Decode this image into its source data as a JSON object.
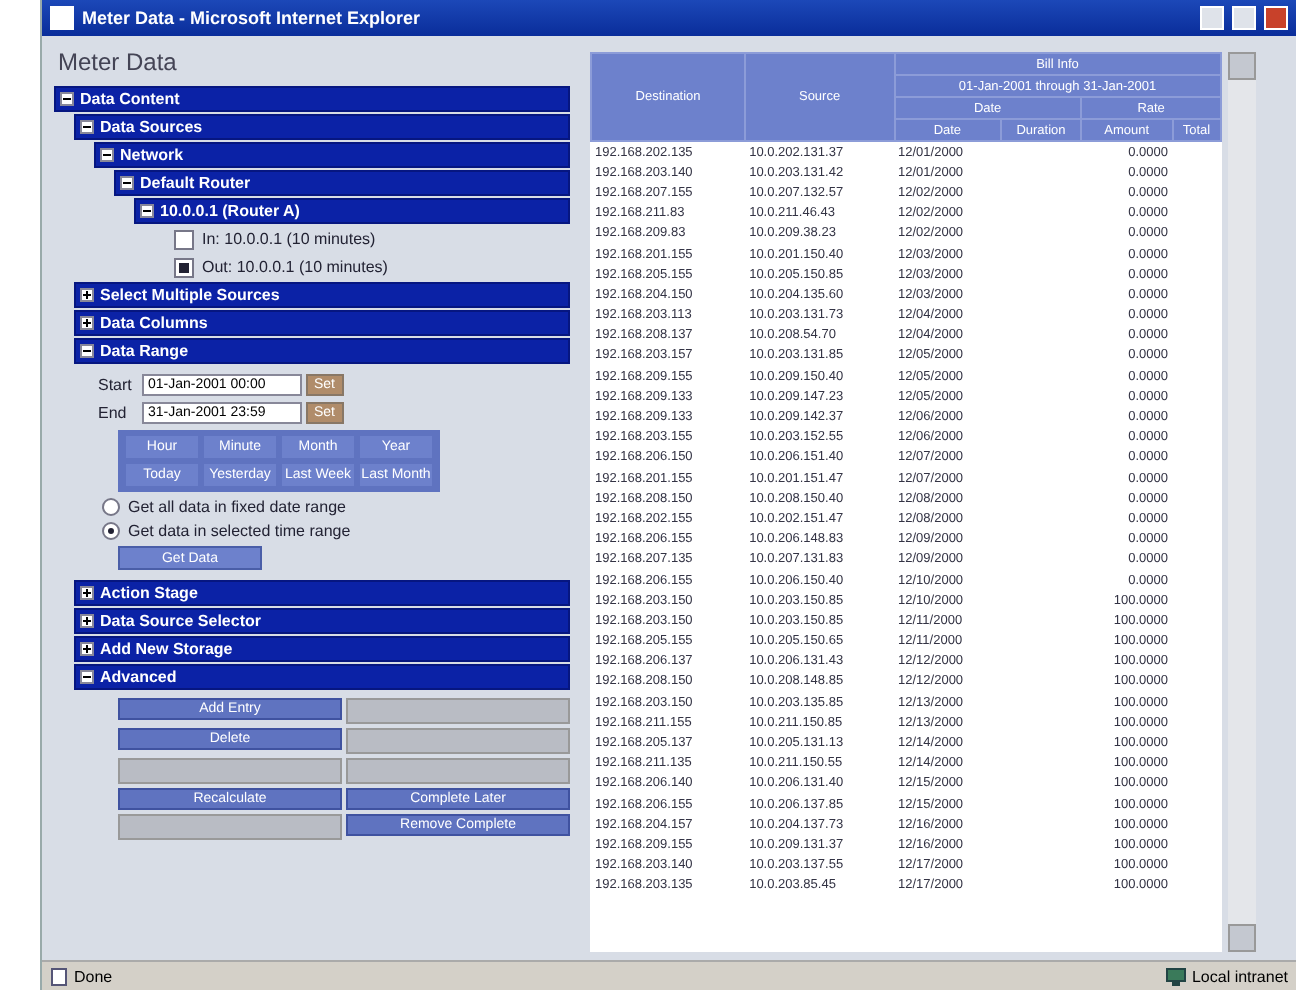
{
  "window": {
    "title": "Meter Data - Microsoft Internet Explorer"
  },
  "page_title": "Meter Data",
  "tree": [
    {
      "label": "Data Content",
      "expanded": true,
      "children": [
        {
          "label": "Data Sources",
          "expanded": true,
          "children": [
            {
              "label": "Network",
              "expanded": true,
              "children": [
                {
                  "label": "Default Router",
                  "expanded": true,
                  "children": [
                    {
                      "label": "10.0.0.1 (Router A)",
                      "expanded": true,
                      "leaves": [
                        {
                          "label": "In: 10.0.0.1 (10 minutes)",
                          "checked": false
                        },
                        {
                          "label": "Out: 10.0.0.1 (10 minutes)",
                          "checked": true
                        }
                      ]
                    }
                  ]
                }
              ]
            }
          ]
        },
        {
          "label": "Select Multiple Sources",
          "expanded": false
        },
        {
          "label": "Data Columns",
          "expanded": false
        },
        {
          "label": "Data Range",
          "expanded": true,
          "form": {
            "start_label": "Start",
            "start_value": "01-Jan-2001 00:00",
            "end_label": "End",
            "end_value": "31-Jan-2001 23:59",
            "start_set": "Set",
            "end_set": "Set",
            "presets": [
              "Hour",
              "Minute",
              "Month",
              "Year",
              "Today",
              "Yesterday",
              "Last Week",
              "Last Month"
            ],
            "options": [
              {
                "label": "Get all data in fixed date range",
                "selected": false
              },
              {
                "label": "Get data in selected time range",
                "selected": true
              }
            ],
            "submit": "Get Data"
          }
        },
        {
          "label": "Action Stage",
          "expanded": false
        },
        {
          "label": "Data Source Selector",
          "expanded": false
        },
        {
          "label": "Add New Storage",
          "expanded": false
        },
        {
          "label": "Advanced",
          "expanded": true,
          "buttons": [
            [
              {
                "kind": "button",
                "label": "Add Entry"
              },
              {
                "kind": "blank"
              }
            ],
            [
              {
                "kind": "button",
                "label": "Delete"
              },
              {
                "kind": "blank"
              }
            ],
            [
              {
                "kind": "blank"
              },
              {
                "kind": "blank"
              }
            ],
            [
              {
                "kind": "button",
                "label": "Recalculate"
              },
              {
                "kind": "button",
                "label": "Complete Later"
              }
            ],
            [
              {
                "kind": "blank"
              },
              {
                "kind": "button",
                "label": "Remove Complete"
              }
            ]
          ]
        }
      ]
    }
  ],
  "table": {
    "columns": [
      "Destination",
      "Source"
    ],
    "group": {
      "title": "Bill Info",
      "subtitle": "01-Jan-2001 through 31-Jan-2001",
      "bands": [
        "Date",
        "Rate"
      ],
      "columns": [
        "Date",
        "Duration",
        "Amount",
        "Total"
      ]
    },
    "rows": [
      [
        "192.168.202.135",
        "10.0.202.131.37",
        "12/01/2000",
        "0.0000"
      ],
      [
        "192.168.203.140",
        "10.0.203.131.42",
        "12/01/2000",
        "0.0000"
      ],
      [
        "192.168.207.155",
        "10.0.207.132.57",
        "12/02/2000",
        "0.0000"
      ],
      [
        "192.168.211.83",
        "10.0.211.46.43",
        "12/02/2000",
        "0.0000"
      ],
      [
        "192.168.209.83",
        "10.0.209.38.23",
        "12/02/2000",
        "0.0000"
      ],
      [
        "192.168.201.155",
        "10.0.201.150.40",
        "12/03/2000",
        "0.0000"
      ],
      [
        "192.168.205.155",
        "10.0.205.150.85",
        "12/03/2000",
        "0.0000"
      ],
      [
        "192.168.204.150",
        "10.0.204.135.60",
        "12/03/2000",
        "0.0000"
      ],
      [
        "192.168.203.113",
        "10.0.203.131.73",
        "12/04/2000",
        "0.0000"
      ],
      [
        "192.168.208.137",
        "10.0.208.54.70",
        "12/04/2000",
        "0.0000"
      ],
      [
        "192.168.203.157",
        "10.0.203.131.85",
        "12/05/2000",
        "0.0000"
      ],
      [
        "192.168.209.155",
        "10.0.209.150.40",
        "12/05/2000",
        "0.0000"
      ],
      [
        "192.168.209.133",
        "10.0.209.147.23",
        "12/05/2000",
        "0.0000"
      ],
      [
        "192.168.209.133",
        "10.0.209.142.37",
        "12/06/2000",
        "0.0000"
      ],
      [
        "192.168.203.155",
        "10.0.203.152.55",
        "12/06/2000",
        "0.0000"
      ],
      [
        "192.168.206.150",
        "10.0.206.151.40",
        "12/07/2000",
        "0.0000"
      ],
      [
        "192.168.201.155",
        "10.0.201.151.47",
        "12/07/2000",
        "0.0000"
      ],
      [
        "192.168.208.150",
        "10.0.208.150.40",
        "12/08/2000",
        "0.0000"
      ],
      [
        "192.168.202.155",
        "10.0.202.151.47",
        "12/08/2000",
        "0.0000"
      ],
      [
        "192.168.206.155",
        "10.0.206.148.83",
        "12/09/2000",
        "0.0000"
      ],
      [
        "192.168.207.135",
        "10.0.207.131.83",
        "12/09/2000",
        "0.0000"
      ],
      [
        "192.168.206.155",
        "10.0.206.150.40",
        "12/10/2000",
        "0.0000"
      ],
      [
        "192.168.203.150",
        "10.0.203.150.85",
        "12/10/2000",
        "100.0000"
      ],
      [
        "192.168.203.150",
        "10.0.203.150.85",
        "12/11/2000",
        "100.0000"
      ],
      [
        "192.168.205.155",
        "10.0.205.150.65",
        "12/11/2000",
        "100.0000"
      ],
      [
        "192.168.206.137",
        "10.0.206.131.43",
        "12/12/2000",
        "100.0000"
      ],
      [
        "192.168.208.150",
        "10.0.208.148.85",
        "12/12/2000",
        "100.0000"
      ],
      [
        "192.168.203.150",
        "10.0.203.135.85",
        "12/13/2000",
        "100.0000"
      ],
      [
        "192.168.211.155",
        "10.0.211.150.85",
        "12/13/2000",
        "100.0000"
      ],
      [
        "192.168.205.137",
        "10.0.205.131.13",
        "12/14/2000",
        "100.0000"
      ],
      [
        "192.168.211.135",
        "10.0.211.150.55",
        "12/14/2000",
        "100.0000"
      ],
      [
        "192.168.206.140",
        "10.0.206.131.40",
        "12/15/2000",
        "100.0000"
      ],
      [
        "192.168.206.155",
        "10.0.206.137.85",
        "12/15/2000",
        "100.0000"
      ],
      [
        "192.168.204.157",
        "10.0.204.137.73",
        "12/16/2000",
        "100.0000"
      ],
      [
        "192.168.209.155",
        "10.0.209.131.37",
        "12/16/2000",
        "100.0000"
      ],
      [
        "192.168.203.140",
        "10.0.203.137.55",
        "12/17/2000",
        "100.0000"
      ],
      [
        "192.168.203.135",
        "10.0.203.85.45",
        "12/17/2000",
        "100.0000"
      ]
    ]
  },
  "status_bar": {
    "left": "Done",
    "right": "Local intranet"
  }
}
